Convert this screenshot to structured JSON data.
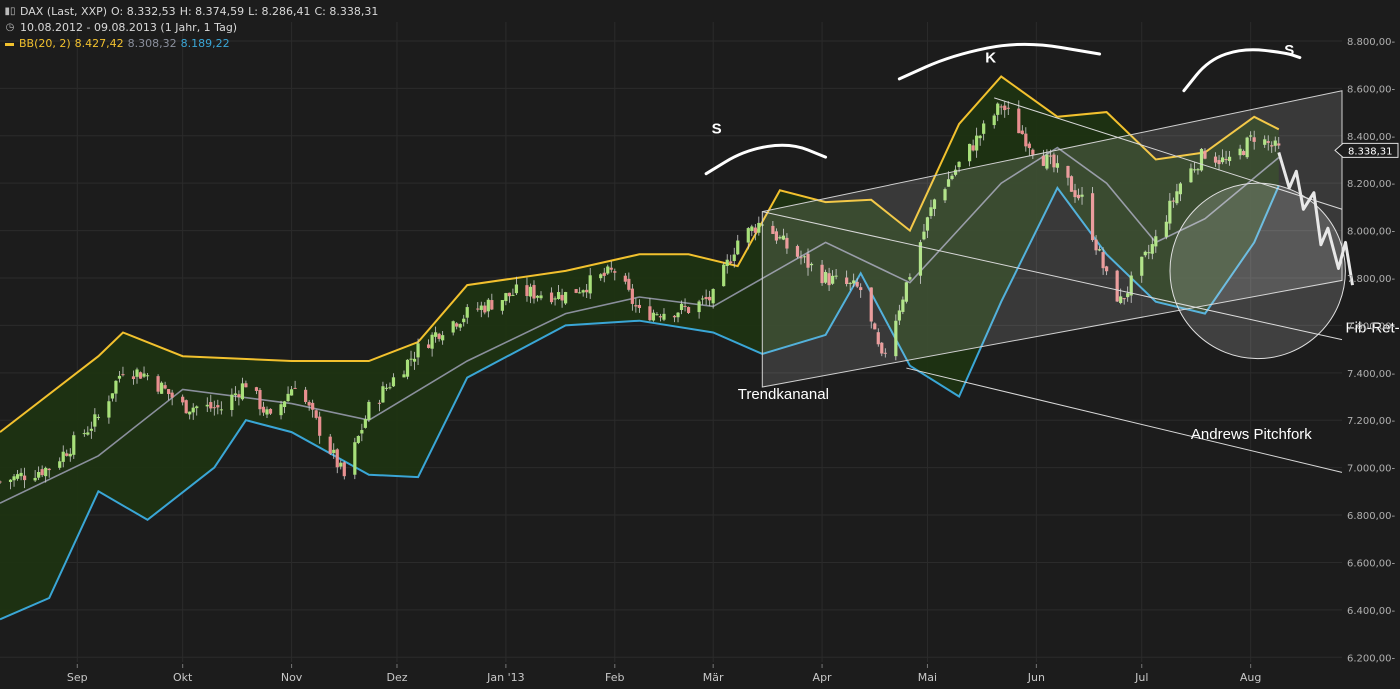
{
  "header": {
    "instrument": "DAX (Last, XXP)",
    "open": "O: 8.332,53",
    "high": "H: 8.374,59",
    "low": "L: 8.286,41",
    "close": "C: 8.338,31",
    "range": "10.08.2012 - 09.08.2013 (1 Jahr, 1 Tag)",
    "bb_label": "BB(20, 2)",
    "bb_upper": "8.427,42",
    "bb_mid": "8.308,32",
    "bb_lower": "8.189,22",
    "chart_icon": "candlestick-chart-icon",
    "clock_icon": "clock-icon"
  },
  "colors": {
    "background": "#1c1c1c",
    "grid": "#2b2b2b",
    "bb_upper": "#f2c12e",
    "bb_mid": "#8a8f9c",
    "bb_lower": "#3aa6d6",
    "band_fill": "#1d3312",
    "candle_up": "#a8e07a",
    "candle_down": "#e88f8f",
    "annotation": "#ffffff"
  },
  "chart_data": {
    "type": "candlestick",
    "title": "DAX (Last, XXP)",
    "period": "10.08.2012 - 09.08.2013 (1 Jahr, 1 Tag)",
    "indicator": "BB(20, 2)",
    "y_ticks": [
      8800,
      8600,
      8400,
      8200,
      8000,
      7800,
      7600,
      7400,
      7200,
      7000,
      6800,
      6600,
      6400,
      6200
    ],
    "y_tick_labels": [
      "8.800,00-",
      "8.600,00-",
      "8.400,00-",
      "8.200,00-",
      "8.000,00-",
      "7.800,00-",
      "7.600,00-",
      "7.400,00-",
      "7.200,00-",
      "7.000,00-",
      "6.800,00-",
      "6.600,00-",
      "6.400,00-",
      "6.200,00-"
    ],
    "ylim": [
      6180,
      8880
    ],
    "x_labels": [
      {
        "label": "Sep",
        "date": "2012-09-01"
      },
      {
        "label": "Okt",
        "date": "2012-10-01"
      },
      {
        "label": "Nov",
        "date": "2012-11-01"
      },
      {
        "label": "Dez",
        "date": "2012-12-01"
      },
      {
        "label": "Jan '13",
        "date": "2013-01-01"
      },
      {
        "label": "Feb",
        "date": "2013-02-01"
      },
      {
        "label": "Mär",
        "date": "2013-03-01"
      },
      {
        "label": "Apr",
        "date": "2013-04-01"
      },
      {
        "label": "Mai",
        "date": "2013-05-01"
      },
      {
        "label": "Jun",
        "date": "2013-06-01"
      },
      {
        "label": "Jul",
        "date": "2013-07-01"
      },
      {
        "label": "Aug",
        "date": "2013-08-01"
      }
    ],
    "xlim": [
      "2012-08-10",
      "2013-08-27"
    ],
    "last_price_label": "8.338,31",
    "last_price": 8338.31,
    "close_series": [
      {
        "date": "2012-08-10",
        "close": 6940
      },
      {
        "date": "2012-08-24",
        "close": 7000
      },
      {
        "date": "2012-09-07",
        "close": 7210
      },
      {
        "date": "2012-09-14",
        "close": 7420
      },
      {
        "date": "2012-09-21",
        "close": 7390
      },
      {
        "date": "2012-10-01",
        "close": 7260
      },
      {
        "date": "2012-10-12",
        "close": 7250
      },
      {
        "date": "2012-10-19",
        "close": 7360
      },
      {
        "date": "2012-10-26",
        "close": 7200
      },
      {
        "date": "2012-11-02",
        "close": 7360
      },
      {
        "date": "2012-11-09",
        "close": 7160
      },
      {
        "date": "2012-11-16",
        "close": 6960
      },
      {
        "date": "2012-11-23",
        "close": 7250
      },
      {
        "date": "2012-12-07",
        "close": 7500
      },
      {
        "date": "2012-12-14",
        "close": 7590
      },
      {
        "date": "2012-12-21",
        "close": 7650
      },
      {
        "date": "2013-01-04",
        "close": 7740
      },
      {
        "date": "2013-01-18",
        "close": 7730
      },
      {
        "date": "2013-02-01",
        "close": 7830
      },
      {
        "date": "2013-02-08",
        "close": 7650
      },
      {
        "date": "2013-02-22",
        "close": 7670
      },
      {
        "date": "2013-03-01",
        "close": 7720
      },
      {
        "date": "2013-03-08",
        "close": 7960
      },
      {
        "date": "2013-03-15",
        "close": 8040
      },
      {
        "date": "2013-03-22",
        "close": 7930
      },
      {
        "date": "2013-04-02",
        "close": 7800
      },
      {
        "date": "2013-04-12",
        "close": 7750
      },
      {
        "date": "2013-04-18",
        "close": 7450
      },
      {
        "date": "2013-04-26",
        "close": 7820
      },
      {
        "date": "2013-05-03",
        "close": 8130
      },
      {
        "date": "2013-05-10",
        "close": 8280
      },
      {
        "date": "2013-05-22",
        "close": 8530
      },
      {
        "date": "2013-05-31",
        "close": 8350
      },
      {
        "date": "2013-06-07",
        "close": 8250
      },
      {
        "date": "2013-06-14",
        "close": 8130
      },
      {
        "date": "2013-06-21",
        "close": 7800
      },
      {
        "date": "2013-06-25",
        "close": 7700
      },
      {
        "date": "2013-07-05",
        "close": 7960
      },
      {
        "date": "2013-07-12",
        "close": 8200
      },
      {
        "date": "2013-07-19",
        "close": 8330
      },
      {
        "date": "2013-07-26",
        "close": 8280
      },
      {
        "date": "2013-08-02",
        "close": 8400
      },
      {
        "date": "2013-08-09",
        "close": 8338.31
      }
    ],
    "bb_upper_series": [
      {
        "date": "2012-08-10",
        "close": 7150
      },
      {
        "date": "2012-09-07",
        "close": 7470
      },
      {
        "date": "2012-09-14",
        "close": 7570
      },
      {
        "date": "2012-10-01",
        "close": 7470
      },
      {
        "date": "2012-11-01",
        "close": 7450
      },
      {
        "date": "2012-11-23",
        "close": 7450
      },
      {
        "date": "2012-12-07",
        "close": 7530
      },
      {
        "date": "2012-12-21",
        "close": 7770
      },
      {
        "date": "2013-01-18",
        "close": 7830
      },
      {
        "date": "2013-02-08",
        "close": 7900
      },
      {
        "date": "2013-02-22",
        "close": 7900
      },
      {
        "date": "2013-03-08",
        "close": 7850
      },
      {
        "date": "2013-03-20",
        "close": 8170
      },
      {
        "date": "2013-04-02",
        "close": 8120
      },
      {
        "date": "2013-04-15",
        "close": 8130
      },
      {
        "date": "2013-04-26",
        "close": 8000
      },
      {
        "date": "2013-05-10",
        "close": 8450
      },
      {
        "date": "2013-05-22",
        "close": 8650
      },
      {
        "date": "2013-06-07",
        "close": 8480
      },
      {
        "date": "2013-06-21",
        "close": 8500
      },
      {
        "date": "2013-07-05",
        "close": 8300
      },
      {
        "date": "2013-07-19",
        "close": 8330
      },
      {
        "date": "2013-08-02",
        "close": 8480
      },
      {
        "date": "2013-08-09",
        "close": 8427.42
      }
    ],
    "bb_mid_series": [
      {
        "date": "2012-08-10",
        "close": 6850
      },
      {
        "date": "2012-09-07",
        "close": 7050
      },
      {
        "date": "2012-10-01",
        "close": 7330
      },
      {
        "date": "2012-11-01",
        "close": 7270
      },
      {
        "date": "2012-11-23",
        "close": 7200
      },
      {
        "date": "2012-12-21",
        "close": 7450
      },
      {
        "date": "2013-01-18",
        "close": 7650
      },
      {
        "date": "2013-02-08",
        "close": 7720
      },
      {
        "date": "2013-03-01",
        "close": 7680
      },
      {
        "date": "2013-04-02",
        "close": 7950
      },
      {
        "date": "2013-04-26",
        "close": 7780
      },
      {
        "date": "2013-05-22",
        "close": 8200
      },
      {
        "date": "2013-06-07",
        "close": 8350
      },
      {
        "date": "2013-06-21",
        "close": 8200
      },
      {
        "date": "2013-07-05",
        "close": 7950
      },
      {
        "date": "2013-07-19",
        "close": 8050
      },
      {
        "date": "2013-08-09",
        "close": 8308.32
      }
    ],
    "bb_lower_series": [
      {
        "date": "2012-08-10",
        "close": 6360
      },
      {
        "date": "2012-08-24",
        "close": 6450
      },
      {
        "date": "2012-09-07",
        "close": 6900
      },
      {
        "date": "2012-09-21",
        "close": 6780
      },
      {
        "date": "2012-10-10",
        "close": 7000
      },
      {
        "date": "2012-10-19",
        "close": 7200
      },
      {
        "date": "2012-11-01",
        "close": 7150
      },
      {
        "date": "2012-11-23",
        "close": 6970
      },
      {
        "date": "2012-12-07",
        "close": 6960
      },
      {
        "date": "2012-12-21",
        "close": 7380
      },
      {
        "date": "2013-01-18",
        "close": 7600
      },
      {
        "date": "2013-02-08",
        "close": 7620
      },
      {
        "date": "2013-03-01",
        "close": 7570
      },
      {
        "date": "2013-03-15",
        "close": 7480
      },
      {
        "date": "2013-04-02",
        "close": 7560
      },
      {
        "date": "2013-04-12",
        "close": 7820
      },
      {
        "date": "2013-04-26",
        "close": 7430
      },
      {
        "date": "2013-05-10",
        "close": 7300
      },
      {
        "date": "2013-05-22",
        "close": 7700
      },
      {
        "date": "2013-06-07",
        "close": 8180
      },
      {
        "date": "2013-06-21",
        "close": 7900
      },
      {
        "date": "2013-07-05",
        "close": 7700
      },
      {
        "date": "2013-07-19",
        "close": 7650
      },
      {
        "date": "2013-08-02",
        "close": 7950
      },
      {
        "date": "2013-08-09",
        "close": 8189.22
      }
    ],
    "annotations": [
      {
        "type": "text",
        "label": "S",
        "date": "2013-03-02",
        "price": 8410
      },
      {
        "type": "text",
        "label": "K",
        "date": "2013-05-19",
        "price": 8710
      },
      {
        "type": "text",
        "label": "S",
        "date": "2013-08-12",
        "price": 8740
      },
      {
        "type": "text",
        "label": "Trendkananal",
        "date": "2013-03-08",
        "price": 7290
      },
      {
        "type": "text",
        "label": "Andrews Pitchfork",
        "date": "2013-07-15",
        "price": 7120
      },
      {
        "type": "text",
        "label": "Fib-Ret-kreis",
        "date": "2013-08-28",
        "price": 7570
      }
    ],
    "trend_channel": {
      "upper": [
        {
          "date": "2013-03-15",
          "price": 8080
        },
        {
          "date": "2013-08-27",
          "price": 8590
        }
      ],
      "lower": [
        {
          "date": "2013-03-15",
          "price": 7340
        },
        {
          "date": "2013-08-27",
          "price": 7790
        }
      ]
    },
    "pitchfork": {
      "upper": [
        {
          "date": "2013-05-20",
          "price": 8560
        },
        {
          "date": "2013-08-27",
          "price": 8090
        }
      ],
      "median": [
        {
          "date": "2013-03-15",
          "price": 8080
        },
        {
          "date": "2013-08-27",
          "price": 7540
        }
      ],
      "lower": [
        {
          "date": "2013-04-25",
          "price": 7420
        },
        {
          "date": "2013-08-27",
          "price": 6980
        }
      ]
    },
    "fib_circle": {
      "center_date": "2013-08-03",
      "center_price": 7830,
      "radius_price": 370
    },
    "projection_zigzag": [
      {
        "date": "2013-08-09",
        "price": 8330
      },
      {
        "date": "2013-08-12",
        "price": 8180
      },
      {
        "date": "2013-08-14",
        "price": 8250
      },
      {
        "date": "2013-08-16",
        "price": 8090
      },
      {
        "date": "2013-08-19",
        "price": 8160
      },
      {
        "date": "2013-08-21",
        "price": 7940
      },
      {
        "date": "2013-08-23",
        "price": 8010
      },
      {
        "date": "2013-08-26",
        "price": 7840
      },
      {
        "date": "2013-08-28",
        "price": 7950
      },
      {
        "date": "2013-08-30",
        "price": 7770
      }
    ],
    "hand_drawn_arcs": [
      [
        {
          "date": "2013-02-27",
          "price": 8240
        },
        {
          "date": "2013-03-10",
          "price": 8340
        },
        {
          "date": "2013-03-23",
          "price": 8370
        },
        {
          "date": "2013-04-02",
          "price": 8310
        }
      ],
      [
        {
          "date": "2013-04-23",
          "price": 8640
        },
        {
          "date": "2013-05-08",
          "price": 8740
        },
        {
          "date": "2013-05-28",
          "price": 8800
        },
        {
          "date": "2013-06-19",
          "price": 8745
        }
      ],
      [
        {
          "date": "2013-07-13",
          "price": 8590
        },
        {
          "date": "2013-07-20",
          "price": 8720
        },
        {
          "date": "2013-07-30",
          "price": 8770
        },
        {
          "date": "2013-08-11",
          "price": 8750
        },
        {
          "date": "2013-08-15",
          "price": 8730
        }
      ]
    ]
  }
}
